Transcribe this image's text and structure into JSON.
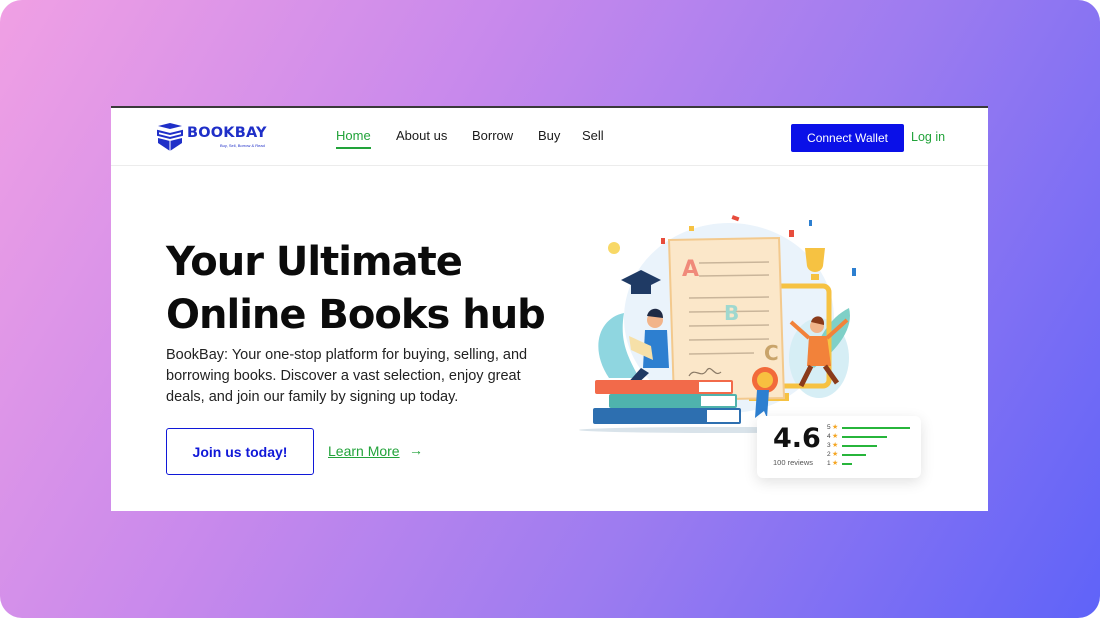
{
  "brand": {
    "name": "BOOKBAY",
    "tagline": "Buy, Sell, Borrow & Read",
    "color": "#1f2fc8"
  },
  "nav": {
    "items": [
      "Home",
      "About us",
      "Borrow",
      "Buy",
      "Sell"
    ],
    "active": "Home"
  },
  "header": {
    "connect_label": "Connect Wallet",
    "login_label": "Log in"
  },
  "hero": {
    "title_line1": "Your Ultimate",
    "title_line2": "Online Books hub",
    "description": "BookBay: Your one-stop platform for buying, selling, and borrowing books. Discover a vast selection, enjoy great deals, and join our family by signing up today.",
    "join_label": "Join us today!",
    "learn_label": "Learn More",
    "learn_arrow": "→"
  },
  "illustration": {
    "letters": [
      "A",
      "B",
      "C"
    ]
  },
  "rating": {
    "score": "4.6",
    "reviews": "100 reviews",
    "rows": [
      {
        "label": "5",
        "fraction": 1.0
      },
      {
        "label": "4",
        "fraction": 0.66
      },
      {
        "label": "3",
        "fraction": 0.52
      },
      {
        "label": "2",
        "fraction": 0.36
      },
      {
        "label": "1",
        "fraction": 0.14
      }
    ]
  },
  "colors": {
    "accent_green": "#22a33a",
    "primary_blue": "#0a10e8",
    "bar_green": "#27b53b"
  }
}
